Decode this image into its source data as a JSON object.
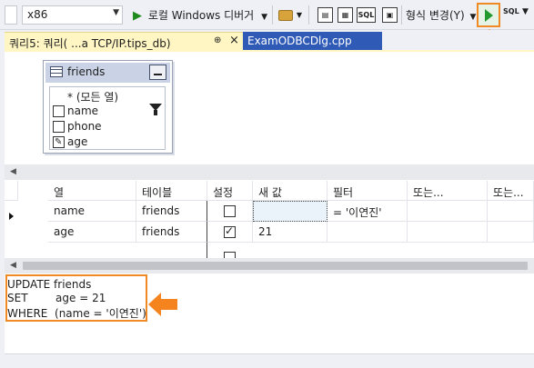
{
  "toolbar": {
    "platform": "x86",
    "run_label": "로컬 Windows 디버거",
    "sql_label": "SQL",
    "format_label": "형식 변경(Y)",
    "sql_check_label": "SQL"
  },
  "tabs": [
    {
      "label": "쿼리5: 쿼리(          ...a TCP/IP.tips_db)",
      "pin": "⊕",
      "close": "×",
      "active": true
    },
    {
      "label": "ExamODBCDlg.cpp",
      "active": false
    }
  ],
  "diagram": {
    "table_name": "friends",
    "columns": [
      {
        "label": "* (모든 열)"
      },
      {
        "label": "name"
      },
      {
        "label": "phone"
      },
      {
        "label": "age"
      }
    ]
  },
  "grid": {
    "headers": [
      "열",
      "테이블",
      "설정",
      "새 값",
      "필터",
      "또는...",
      "또는..."
    ],
    "rows": [
      {
        "column": "name",
        "table": "friends",
        "set": false,
        "new_value": "",
        "filter": "= '이연진'"
      },
      {
        "column": "age",
        "table": "friends",
        "set": true,
        "new_value": "21",
        "filter": ""
      }
    ]
  },
  "sql": {
    "line1": "UPDATE friends",
    "line2": "SET        age = 21",
    "line3": "WHERE  (name = '이연진')"
  },
  "colors": {
    "accent_orange": "#f5841f",
    "tab_active_bg": "#fff6c4",
    "tab_inactive_bg": "#2f5bb7",
    "run_green": "#1e8a1e"
  }
}
